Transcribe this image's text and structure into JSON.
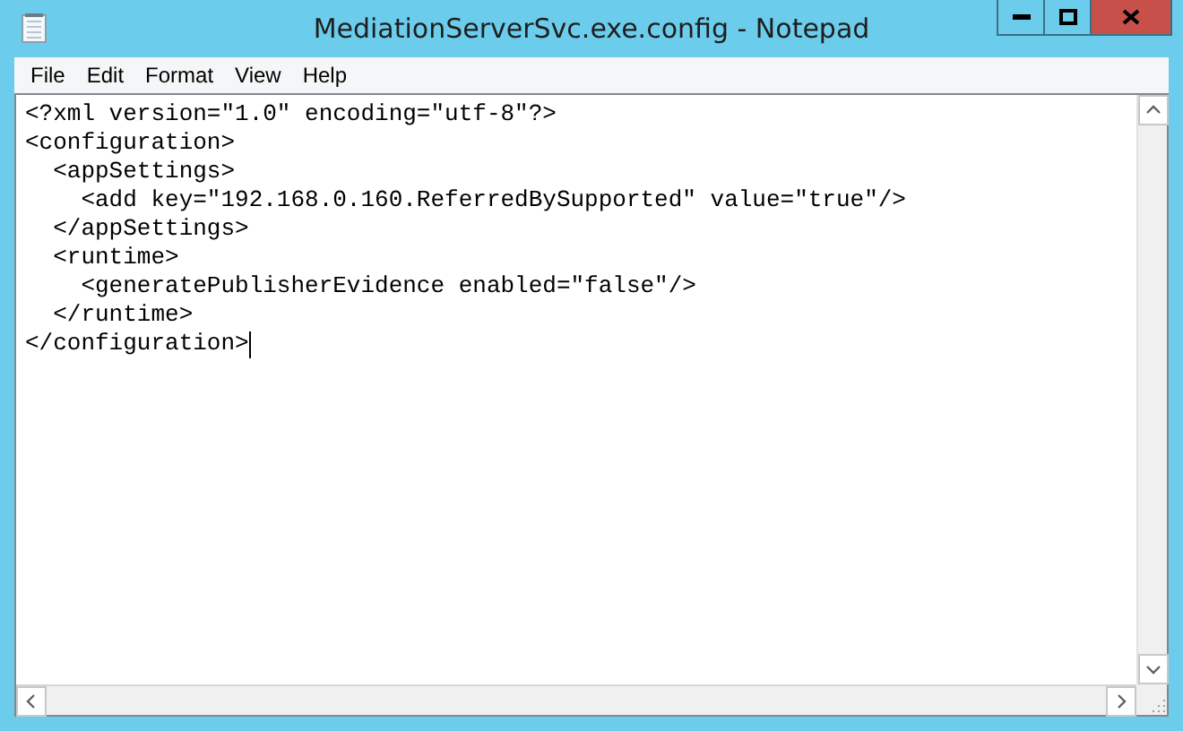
{
  "window": {
    "title": "MediationServerSvc.exe.config - Notepad"
  },
  "menu": [
    "File",
    "Edit",
    "Format",
    "View",
    "Help"
  ],
  "editor": {
    "lines": [
      "<?xml version=\"1.0\" encoding=\"utf-8\"?>",
      "<configuration>",
      "  <appSettings>",
      "    <add key=\"192.168.0.160.ReferredBySupported\" value=\"true\"/>",
      "  </appSettings>",
      "  <runtime>",
      "    <generatePublisherEvidence enabled=\"false\"/>",
      "  </runtime>",
      "</configuration>"
    ]
  }
}
